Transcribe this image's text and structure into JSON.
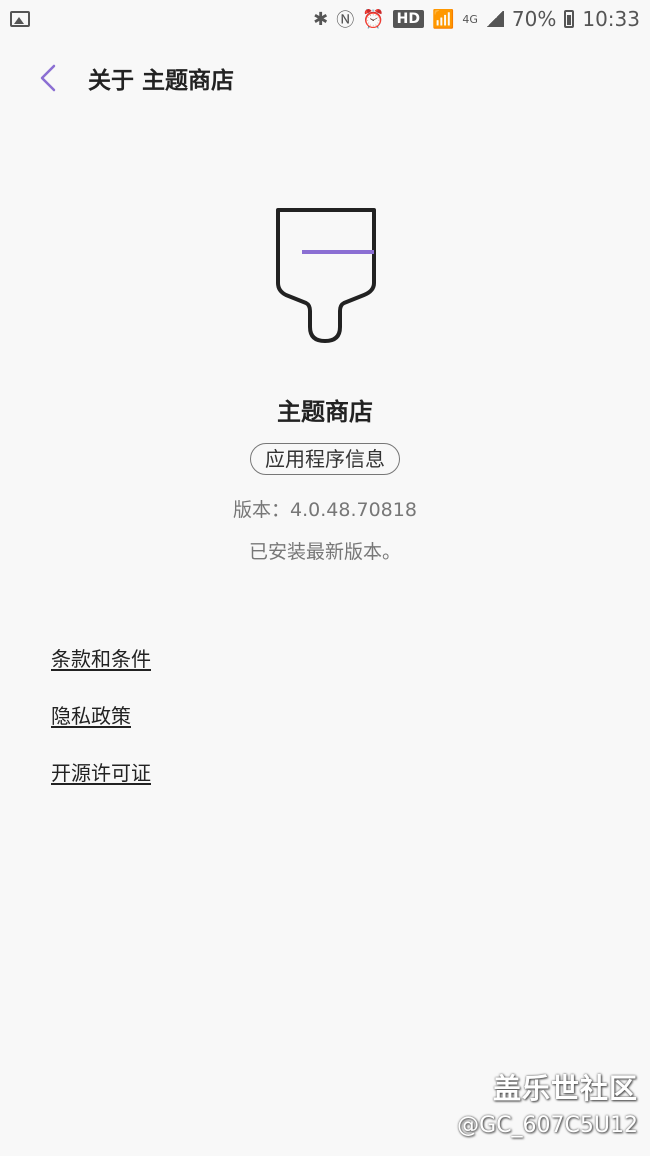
{
  "status_bar": {
    "hd": "HD",
    "network": "4G",
    "battery_percent": "70%",
    "time": "10:33",
    "icons": [
      "gallery-icon",
      "bluetooth-icon",
      "nfc-icon",
      "alarm-icon",
      "wifi-icon",
      "signal-icon",
      "battery-icon"
    ]
  },
  "appbar": {
    "title": "关于 主题商店",
    "back_icon": "chevron-left-icon",
    "accent_color": "#8b6fd3"
  },
  "app": {
    "icon": "paintbrush-icon",
    "name": "主题商店",
    "info_button": "应用程序信息",
    "version": "版本：4.0.48.70818",
    "status": "已安装最新版本。"
  },
  "links": [
    {
      "label": "条款和条件"
    },
    {
      "label": "隐私政策"
    },
    {
      "label": "开源许可证"
    }
  ],
  "watermark": {
    "line1": "盖乐世社区",
    "line2": "@GC_607C5U12"
  }
}
